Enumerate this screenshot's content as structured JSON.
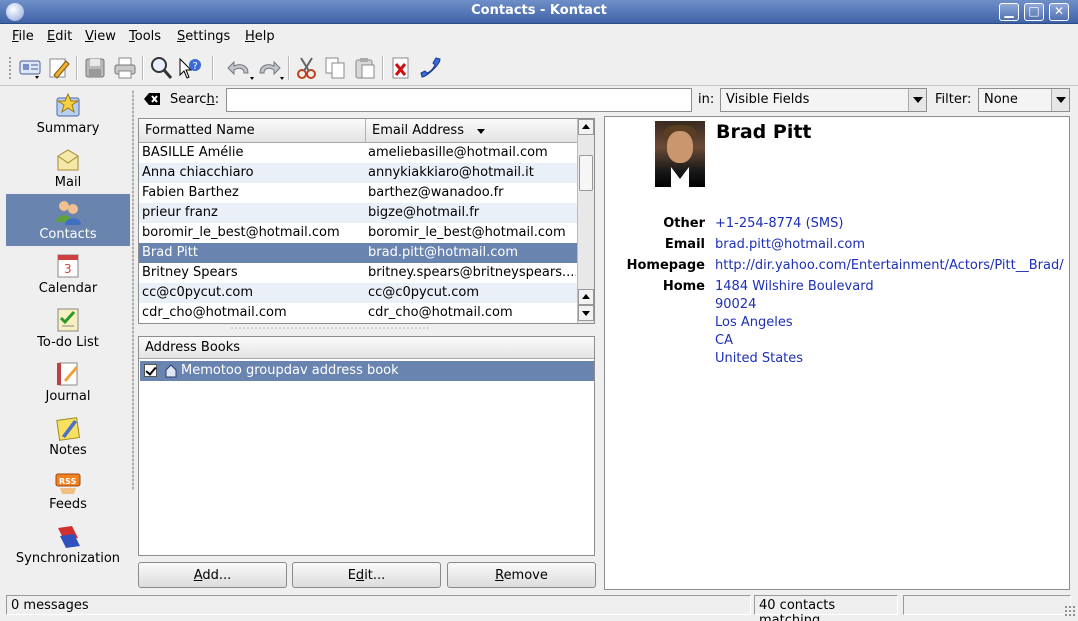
{
  "window": {
    "title": "Contacts - Kontact"
  },
  "menu": [
    {
      "pre": "",
      "accel": "F",
      "post": "ile"
    },
    {
      "pre": "",
      "accel": "E",
      "post": "dit"
    },
    {
      "pre": "",
      "accel": "V",
      "post": "iew"
    },
    {
      "pre": "",
      "accel": "T",
      "post": "ools"
    },
    {
      "pre": "",
      "accel": "S",
      "post": "ettings"
    },
    {
      "pre": "",
      "accel": "H",
      "post": "elp"
    }
  ],
  "sidebar": {
    "items": [
      {
        "label": "Summary"
      },
      {
        "label": "Mail"
      },
      {
        "label": "Contacts"
      },
      {
        "label": "Calendar"
      },
      {
        "label": "To-do List"
      },
      {
        "label": "Journal"
      },
      {
        "label": "Notes"
      },
      {
        "label": "Feeds"
      },
      {
        "label": "Synchronization"
      }
    ]
  },
  "search": {
    "label_pre": "Searc",
    "label_accel": "h",
    "label_post": ":",
    "value": "",
    "in_label": "in:",
    "in_value": "Visible Fields",
    "filter_label": "Filter:",
    "filter_value": "None"
  },
  "contacts": {
    "columns": [
      "Formatted Name",
      "Email Address"
    ],
    "rows": [
      {
        "name": "BASILLE Amélie",
        "email": "ameliebasille@hotmail.com"
      },
      {
        "name": "Anna chiacchiaro",
        "email": "annykiakkiaro@hotmail.it"
      },
      {
        "name": "Fabien Barthez",
        "email": "barthez@wanadoo.fr"
      },
      {
        "name": "prieur franz",
        "email": "bigze@hotmail.fr"
      },
      {
        "name": "boromir_le_best@hotmail.com",
        "email": "boromir_le_best@hotmail.com"
      },
      {
        "name": "Brad Pitt",
        "email": "brad.pitt@hotmail.com"
      },
      {
        "name": "Britney Spears",
        "email": "britney.spears@britneyspears...."
      },
      {
        "name": "cc@c0pycut.com",
        "email": "cc@c0pycut.com"
      },
      {
        "name": "cdr_cho@hotmail.com",
        "email": "cdr_cho@hotmail.com"
      }
    ]
  },
  "address_books": {
    "header": "Address Books",
    "items": [
      {
        "label": "Memotoo groupdav address book"
      }
    ]
  },
  "buttons": {
    "add": {
      "pre": "",
      "accel": "A",
      "post": "dd..."
    },
    "edit": {
      "pre": "E",
      "accel": "d",
      "post": "it..."
    },
    "remove": {
      "pre": "",
      "accel": "R",
      "post": "emove"
    }
  },
  "details": {
    "name": "Brad Pitt",
    "other_label": "Other",
    "other_value": "+1-254-8774",
    "other_suffix": "(SMS)",
    "email_label": "Email",
    "email_value": "brad.pitt@hotmail.com",
    "homepage_label": "Homepage",
    "homepage_value": "http://dir.yahoo.com/Entertainment/Actors/Pitt__Brad/",
    "home_label": "Home",
    "home_lines": [
      "1484 Wilshire Boulevard",
      "90024",
      "Los Angeles",
      "CA",
      "United States"
    ]
  },
  "status": {
    "messages": "0 messages",
    "matching": "40 contacts matching",
    "extra": ""
  },
  "colors": {
    "selection": "#6a84b0",
    "link": "#1d2fb6",
    "titlebar": "#4f6fb4"
  }
}
